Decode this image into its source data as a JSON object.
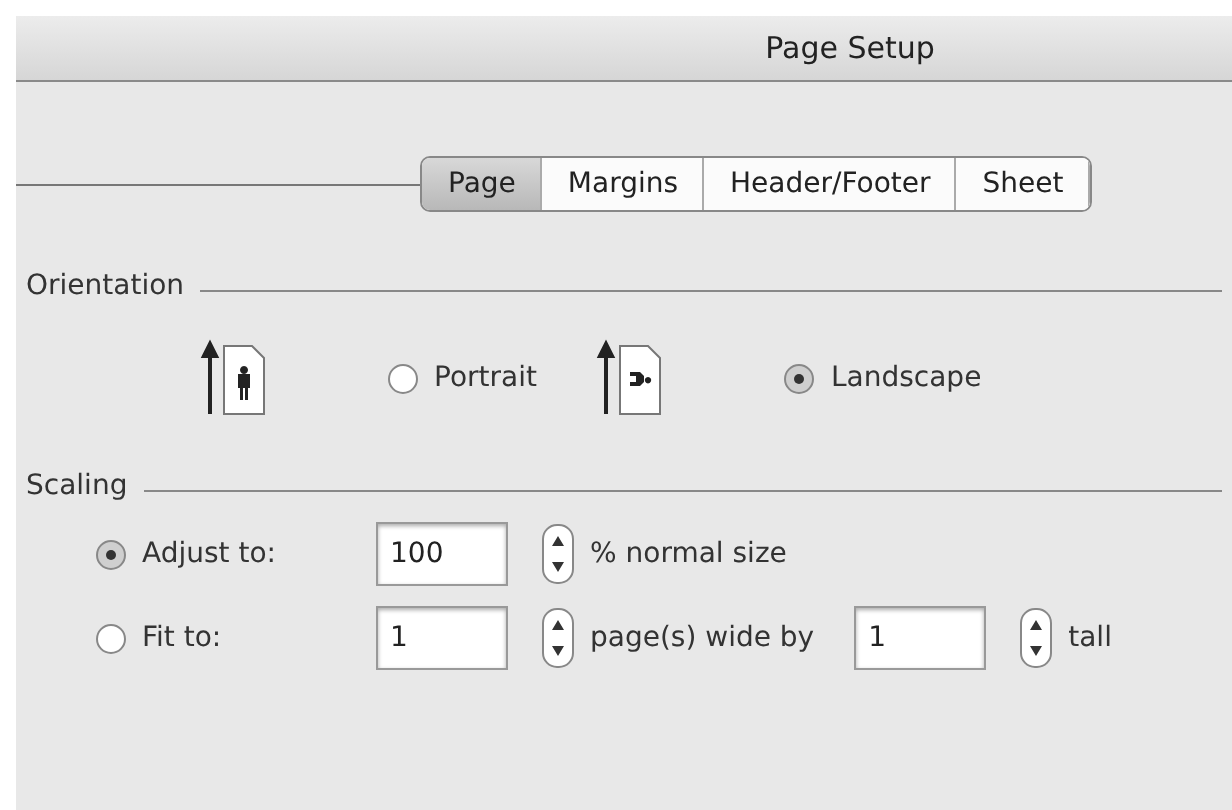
{
  "window": {
    "title": "Page Setup"
  },
  "tabs": [
    {
      "label": "Page",
      "selected": true
    },
    {
      "label": "Margins",
      "selected": false
    },
    {
      "label": "Header/Footer",
      "selected": false
    },
    {
      "label": "Sheet",
      "selected": false
    }
  ],
  "orientation": {
    "label": "Orientation",
    "options": [
      {
        "kind": "portrait",
        "label": "Portrait",
        "selected": false
      },
      {
        "kind": "landscape",
        "label": "Landscape",
        "selected": true
      }
    ]
  },
  "scaling": {
    "label": "Scaling",
    "rows": [
      {
        "label": "Adjust to:",
        "selected": true,
        "parts": [
          {
            "kind": "field",
            "value": "100"
          },
          {
            "kind": "text",
            "text": "% normal size"
          }
        ]
      },
      {
        "label": "Fit to:",
        "selected": false,
        "parts": [
          {
            "kind": "field",
            "value": "1"
          },
          {
            "kind": "text",
            "text": "page(s) wide by"
          },
          {
            "kind": "field",
            "value": "1"
          },
          {
            "kind": "text",
            "text": "tall"
          }
        ]
      }
    ]
  }
}
